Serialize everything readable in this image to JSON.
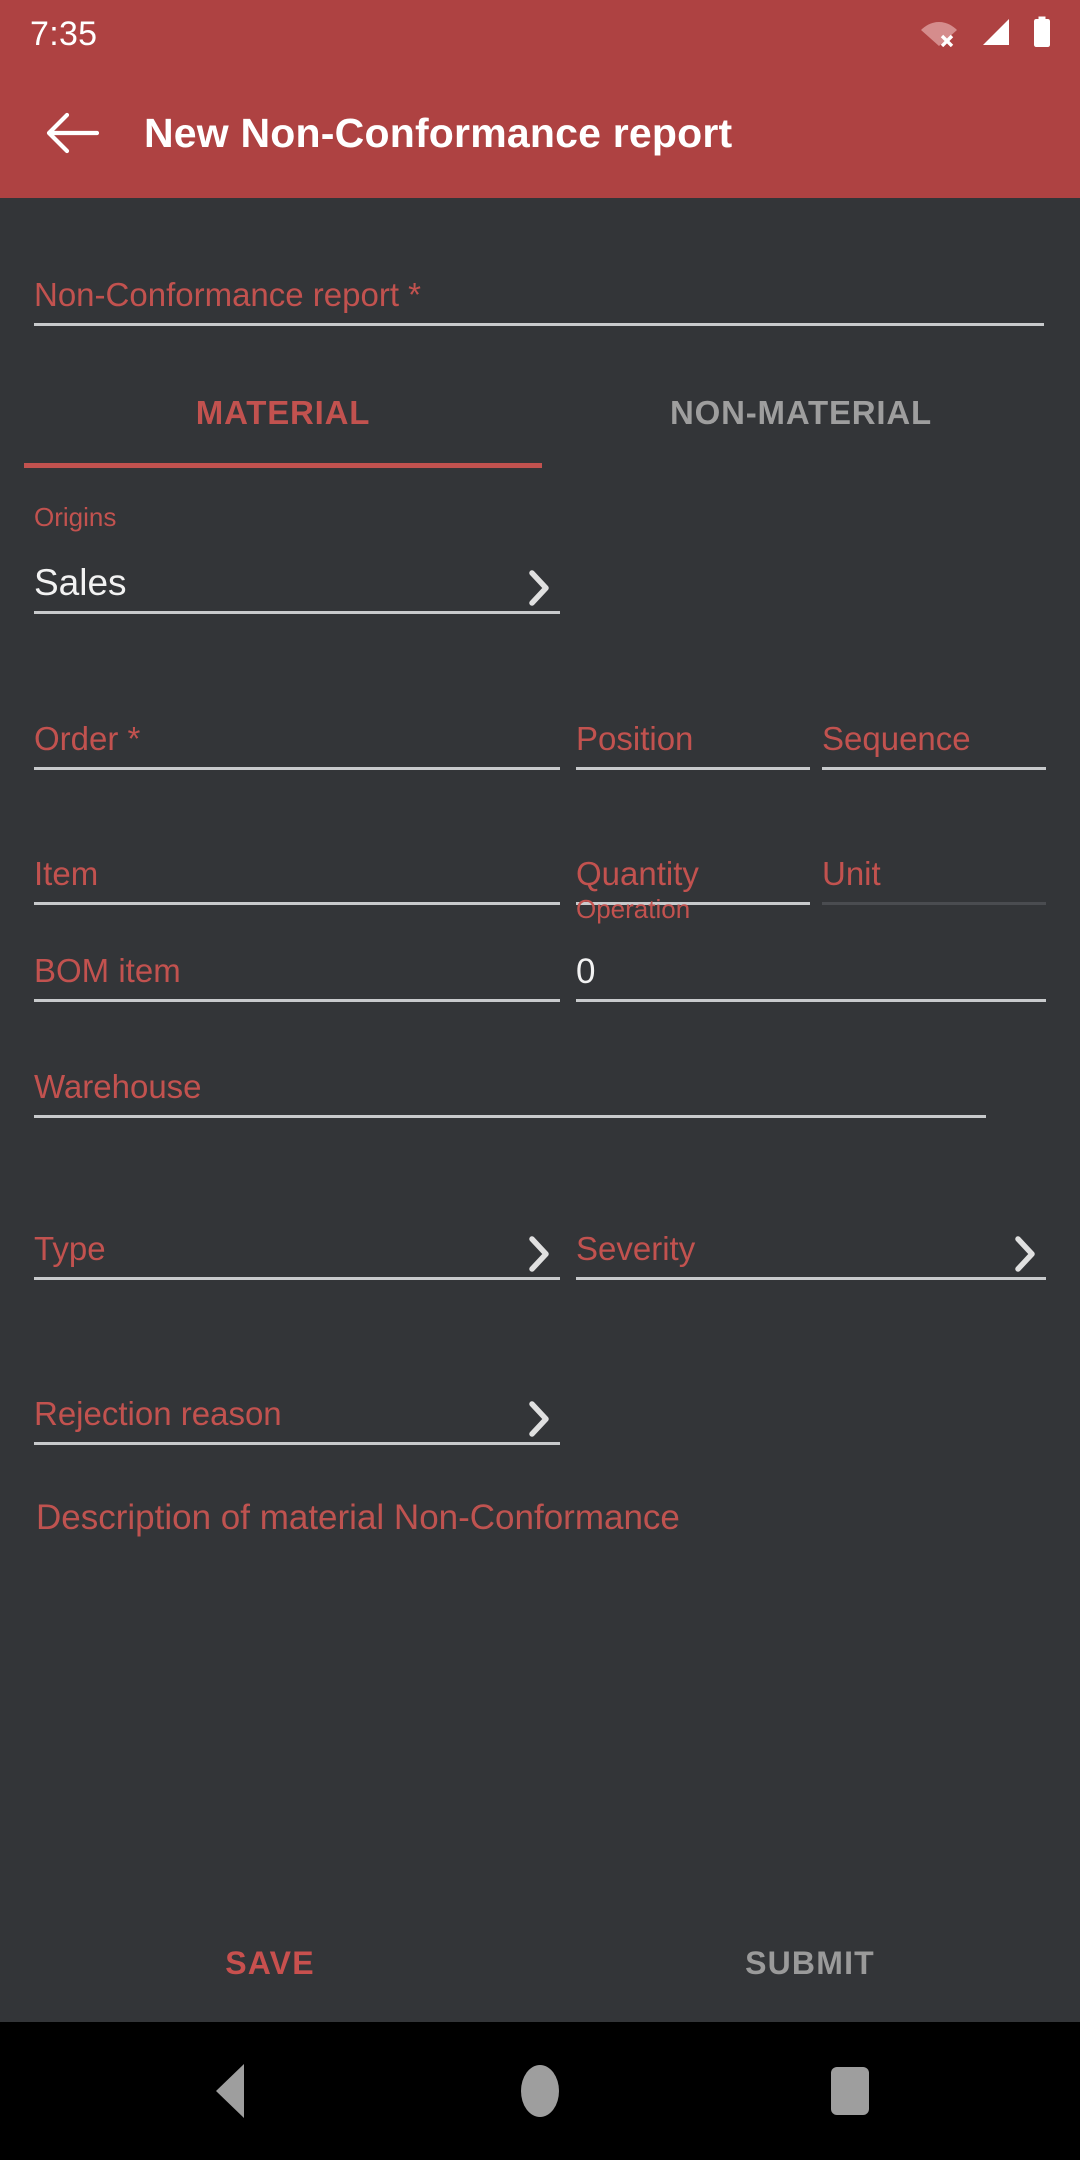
{
  "status_bar": {
    "time": "7:35",
    "icons": [
      "wifi-off-icon",
      "cell-signal-icon",
      "battery-full-icon"
    ]
  },
  "app_bar": {
    "back_icon": "arrow-left-icon",
    "title": "New Non-Conformance report"
  },
  "colors": {
    "primary": "#AE4242",
    "accent": "#C2524F",
    "background": "#333538",
    "rule": "#C8CACC",
    "rule_disabled": "#4A4C50",
    "text_primary": "#F2F2F2",
    "text_muted": "#9E9E9E"
  },
  "form": {
    "report_field": {
      "label": "Non-Conformance report *",
      "value": ""
    },
    "tabs": [
      {
        "label": "MATERIAL",
        "active": true
      },
      {
        "label": "NON-MATERIAL",
        "active": false
      }
    ],
    "origins": {
      "label": "Origins",
      "value": "Sales",
      "chevron": "chevron-right-icon"
    },
    "fields": [
      {
        "label": "Order *",
        "value": ""
      },
      {
        "label": "Position",
        "value": ""
      },
      {
        "label": "Sequence",
        "value": ""
      },
      {
        "label": "Item",
        "value": ""
      },
      {
        "label": "Quantity",
        "value": ""
      },
      {
        "label": "Unit",
        "value": "",
        "disabled": true
      },
      {
        "label": "BOM item",
        "value": ""
      },
      {
        "label": "Operation",
        "value": "0"
      },
      {
        "label": "Warehouse",
        "value": ""
      },
      {
        "label": "Type",
        "value": "",
        "chevron": "chevron-right-icon"
      },
      {
        "label": "Severity",
        "value": "",
        "chevron": "chevron-right-icon"
      },
      {
        "label": "Rejection reason",
        "value": "",
        "chevron": "chevron-right-icon"
      }
    ],
    "description": {
      "label": "Description of material Non-Conformance",
      "value": ""
    }
  },
  "actions": {
    "save_label": "SAVE",
    "submit_label": "SUBMIT"
  },
  "nav_bar": {
    "back": "triangle-back-icon",
    "home": "circle-home-icon",
    "recents": "square-recents-icon"
  }
}
